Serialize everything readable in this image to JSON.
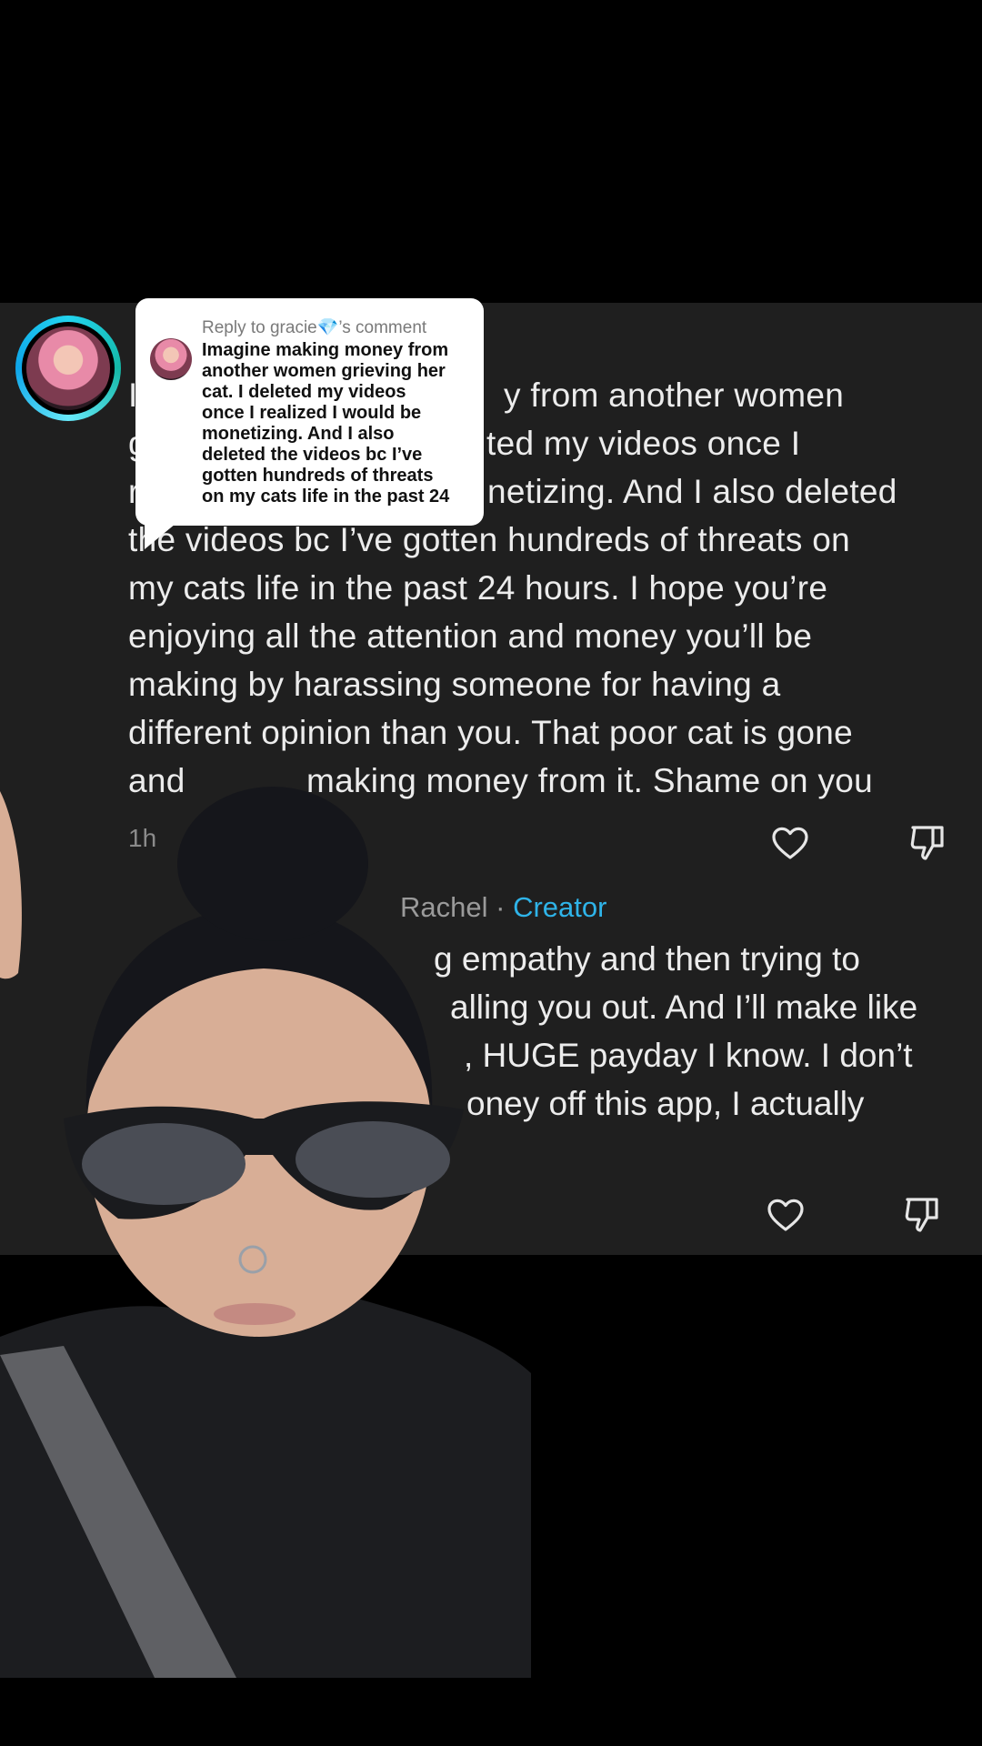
{
  "comment": {
    "text_lines": [
      "I",
      "y from another women",
      "g",
      "ted my videos once I",
      "r",
      "netizing. And I also deleted",
      "the videos bc I’ve gotten hundreds of threats on",
      "my cats life in the past 24 hours. I hope you’re",
      "enjoying all the attention and money you’ll be",
      "making by harassing someone for having a",
      "different opinion than you. That poor cat is gone",
      "and",
      "making money from it. Shame on you"
    ],
    "timestamp": "1h",
    "like_icon": "heart-outline-icon",
    "dislike_icon": "thumbs-down-outline-icon"
  },
  "reply": {
    "author": "Rachel",
    "separator": "·",
    "badge": "Creator",
    "text_lines": [
      "g empathy and then trying to",
      "alling you out. And I’ll make like",
      ", HUGE payday I know. I don’t",
      "oney off this app, I actually"
    ],
    "like_icon": "heart-outline-icon",
    "dislike_icon": "thumbs-down-outline-icon"
  },
  "reply_bubble": {
    "title": "Reply to gracie💎’s comment",
    "text_lines": [
      "Imagine making money from",
      "another women grieving her",
      "cat. I deleted my videos",
      "once I realized I would be",
      "monetizing. And I also",
      "deleted the videos bc I’ve",
      "gotten hundreds of threats",
      "on my cats life in the past 24"
    ]
  },
  "colors": {
    "panel": "#1f1f1f",
    "creator_badge": "#2fb4e9",
    "ring": "#22d3ee"
  }
}
